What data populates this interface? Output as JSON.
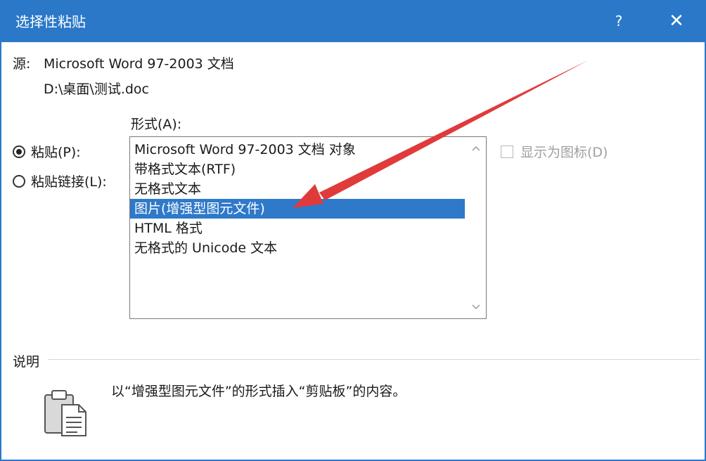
{
  "window": {
    "title": "选择性粘贴",
    "help_label": "?",
    "close_label": "✕"
  },
  "source": {
    "label": "源:",
    "value": "Microsoft Word 97-2003 文档",
    "path": "D:\\桌面\\测试.doc"
  },
  "options": {
    "paste_label": "粘贴(P):",
    "paste_checked": true,
    "paste_link_label": "粘贴链接(L):",
    "paste_link_checked": false
  },
  "format": {
    "label": "形式(A):",
    "items": [
      "Microsoft Word 97-2003 文档 对象",
      "带格式文本(RTF)",
      "无格式文本",
      "图片(增强型图元文件)",
      "HTML 格式",
      "无格式的 Unicode 文本"
    ],
    "selected_index": 3
  },
  "display_as_icon": {
    "label": "显示为图标(D)",
    "checked": false,
    "enabled": false
  },
  "description": {
    "header": "说明",
    "text": "以“增强型图元文件”的形式插入“剪贴板”的内容。"
  },
  "colors": {
    "title_bar": "#2b78c8",
    "selection": "#2e79c9",
    "annotation_arrow": "#e03a3a"
  },
  "icons": {
    "clipboard": "clipboard-icon",
    "scroll_up": "chevron-up-icon",
    "scroll_down": "chevron-down-icon"
  }
}
